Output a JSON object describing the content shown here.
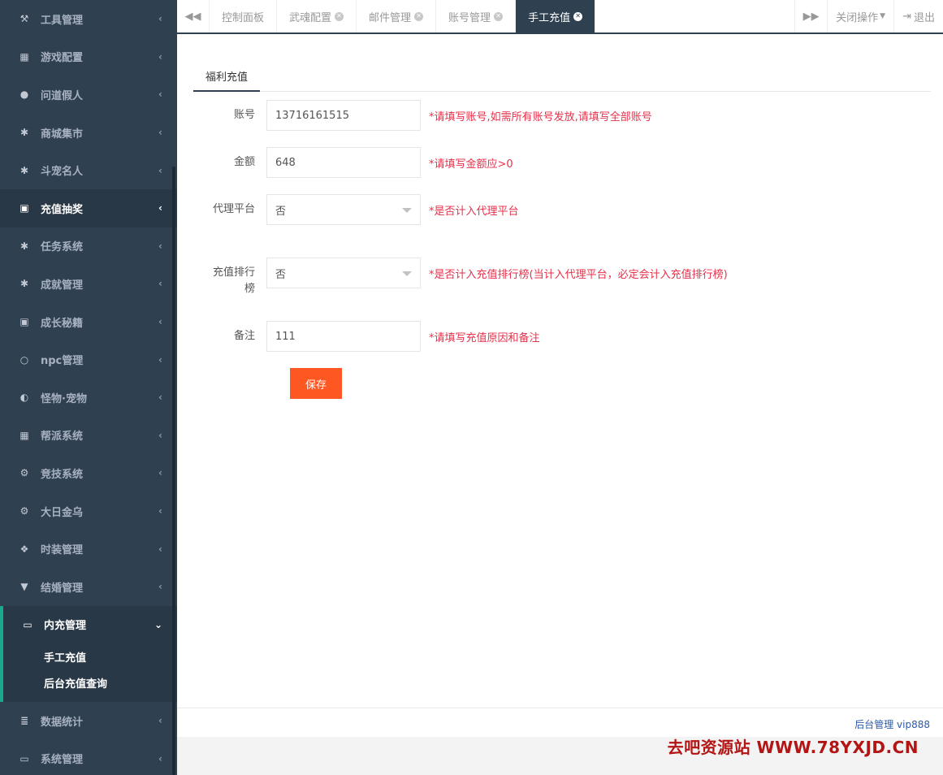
{
  "sidebar": {
    "items": [
      {
        "label": "工具管理",
        "icon": "fork-knife-icon",
        "glyph": "⚒"
      },
      {
        "label": "游戏配置",
        "icon": "grid-icon",
        "glyph": "▦"
      },
      {
        "label": "问道假人",
        "icon": "user-icon",
        "glyph": "●"
      },
      {
        "label": "商城集市",
        "icon": "gear-icon",
        "glyph": "✱"
      },
      {
        "label": "斗宠名人",
        "icon": "gear-icon",
        "glyph": "✱"
      },
      {
        "label": "充值抽奖",
        "icon": "money-icon",
        "glyph": "▣"
      },
      {
        "label": "任务系统",
        "icon": "gear-icon",
        "glyph": "✱"
      },
      {
        "label": "成就管理",
        "icon": "gear-icon",
        "glyph": "✱"
      },
      {
        "label": "成长秘籍",
        "icon": "money-icon",
        "glyph": "▣"
      },
      {
        "label": "npc管理",
        "icon": "circle-icon",
        "glyph": "○"
      },
      {
        "label": "怪物·宠物",
        "icon": "half-circle-icon",
        "glyph": "◐"
      },
      {
        "label": "帮派系统",
        "icon": "grid-icon",
        "glyph": "▦"
      },
      {
        "label": "竞技系统",
        "icon": "cogs-icon",
        "glyph": "⚙"
      },
      {
        "label": "大日金乌",
        "icon": "cogs-icon",
        "glyph": "⚙"
      },
      {
        "label": "时装管理",
        "icon": "cubes-icon",
        "glyph": "❖"
      },
      {
        "label": "结婚管理",
        "icon": "glass-icon",
        "glyph": "▼"
      }
    ],
    "active_group": {
      "label": "内充管理",
      "icon": "desktop-icon",
      "glyph": "▭",
      "children": [
        "手工充值",
        "后台充值查询"
      ]
    },
    "after": [
      {
        "label": "数据统计",
        "icon": "database-icon",
        "glyph": "≣"
      },
      {
        "label": "系统管理",
        "icon": "desktop-icon",
        "glyph": "▭"
      }
    ]
  },
  "tabbar": {
    "tabs": [
      "控制面板",
      "武魂配置",
      "邮件管理",
      "账号管理",
      "手工充值"
    ],
    "active_tab": "手工充值",
    "close_ops": "关闭操作",
    "logout": "退出"
  },
  "form": {
    "subtab": "福利充值",
    "fields": [
      {
        "label": "账号",
        "value": "13716161515",
        "hint": "*请填写账号,如需所有账号发放,请填写全部账号"
      },
      {
        "label": "金额",
        "value": "648",
        "hint": "*请填写金额应>0"
      },
      {
        "label": "代理平台",
        "value": "否",
        "hint": "*是否计入代理平台"
      },
      {
        "label": "充值排行榜",
        "value": "否",
        "hint": "*是否计入充值排行榜(当计入代理平台，必定会计入充值排行榜)"
      },
      {
        "label": "备注",
        "value": "111",
        "hint": "*请填写充值原因和备注"
      }
    ],
    "save_label": "保存"
  },
  "footer": {
    "text": "后台管理 vip888"
  },
  "watermark": "去吧资源站 WWW.78YXJD.CN",
  "colors": {
    "sidebar_bg": "#2f4050",
    "active_accent": "#19aa8d",
    "save_button": "#ff5722",
    "hint_red": "#e8304a"
  }
}
